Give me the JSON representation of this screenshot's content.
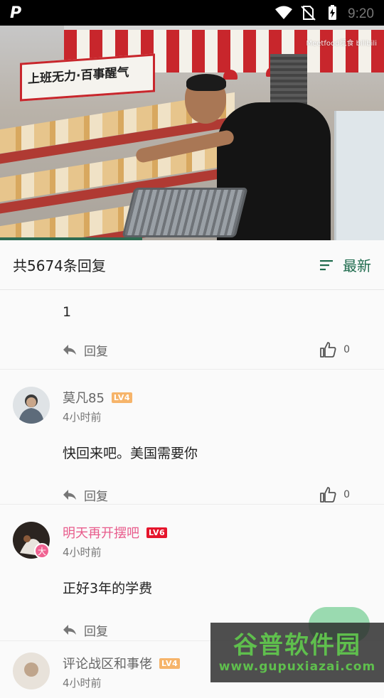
{
  "status_bar": {
    "app_logo": "P",
    "time": "9:20",
    "icons": [
      "wifi-icon",
      "no-sim-icon",
      "battery-charging-icon"
    ]
  },
  "video": {
    "watermark": "Meetfood觅食 bilibili",
    "sign_text": "上班无力·百事醒气",
    "progress_fraction": 0.37
  },
  "reply_header": {
    "count_label": "共5674条回复",
    "sort_label": "最新",
    "sort_icon": "sort-lines-icon"
  },
  "comments": [
    {
      "text": "1",
      "reply_label": "回复",
      "likes": "0"
    },
    {
      "username": "莫凡85",
      "level": "LV4",
      "time": "4小时前",
      "text": "快回来吧。美国需要你",
      "reply_label": "回复",
      "likes": "0"
    },
    {
      "username": "明天再开摆吧",
      "level": "LV6",
      "badge": "大",
      "time": "4小时前",
      "text": "正好3年的学费",
      "reply_label": "回复"
    },
    {
      "username": "评论战区和事佬",
      "level": "LV4",
      "time": "4小时前"
    }
  ],
  "site_watermark": {
    "title": "谷普软件园",
    "url": "www.gupuxiazai.com"
  },
  "colors": {
    "accent_green": "#1e6b4d",
    "vip_pink": "#e85c8c",
    "lv_orange": "#f6b46a",
    "lv_red": "#e5152c"
  }
}
